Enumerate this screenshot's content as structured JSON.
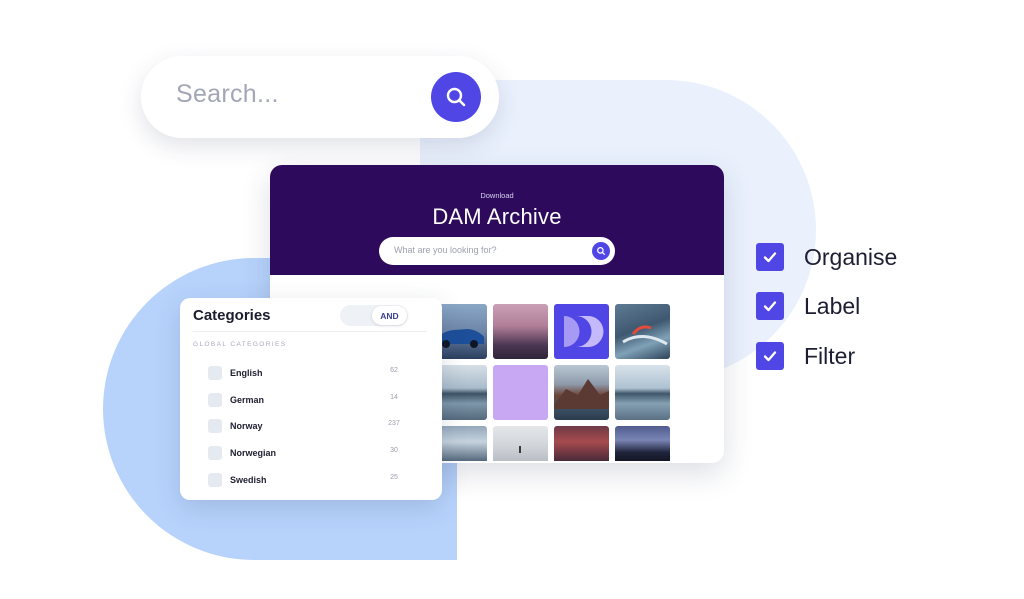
{
  "search": {
    "placeholder": "Search...",
    "icon": "search-icon"
  },
  "dam": {
    "kicker": "Download",
    "title": "DAM Archive",
    "search_placeholder": "What are you looking for?",
    "header_color": "#2d0a5c",
    "thumbnails": [
      "car-photo",
      "pink-sunset-photo",
      "purple-logo-tile",
      "surfer-photo",
      "misty-lake-photo",
      "lavender-tile",
      "rocky-coast-photo",
      "misty-lake-photo",
      "cloudy-sky-photo",
      "beach-walker-photo",
      "red-water-photo",
      "harbor-night-photo"
    ]
  },
  "categories": {
    "title": "Categories",
    "toggle_label": "AND",
    "section_label": "GLOBAL CATEGORIES",
    "items": [
      {
        "label": "English",
        "count": "62"
      },
      {
        "label": "German",
        "count": "14"
      },
      {
        "label": "Norway",
        "count": "237"
      },
      {
        "label": "Norwegian",
        "count": "30"
      },
      {
        "label": "Swedish",
        "count": "25"
      }
    ]
  },
  "features": [
    {
      "label": "Organise",
      "icon": "checkmark-icon"
    },
    {
      "label": "Label",
      "icon": "checkmark-icon"
    },
    {
      "label": "Filter",
      "icon": "checkmark-icon"
    }
  ],
  "colors": {
    "accent": "#4f46e5",
    "blob_light": "#eaf1fd",
    "blob_blue": "#b7d3fc"
  }
}
